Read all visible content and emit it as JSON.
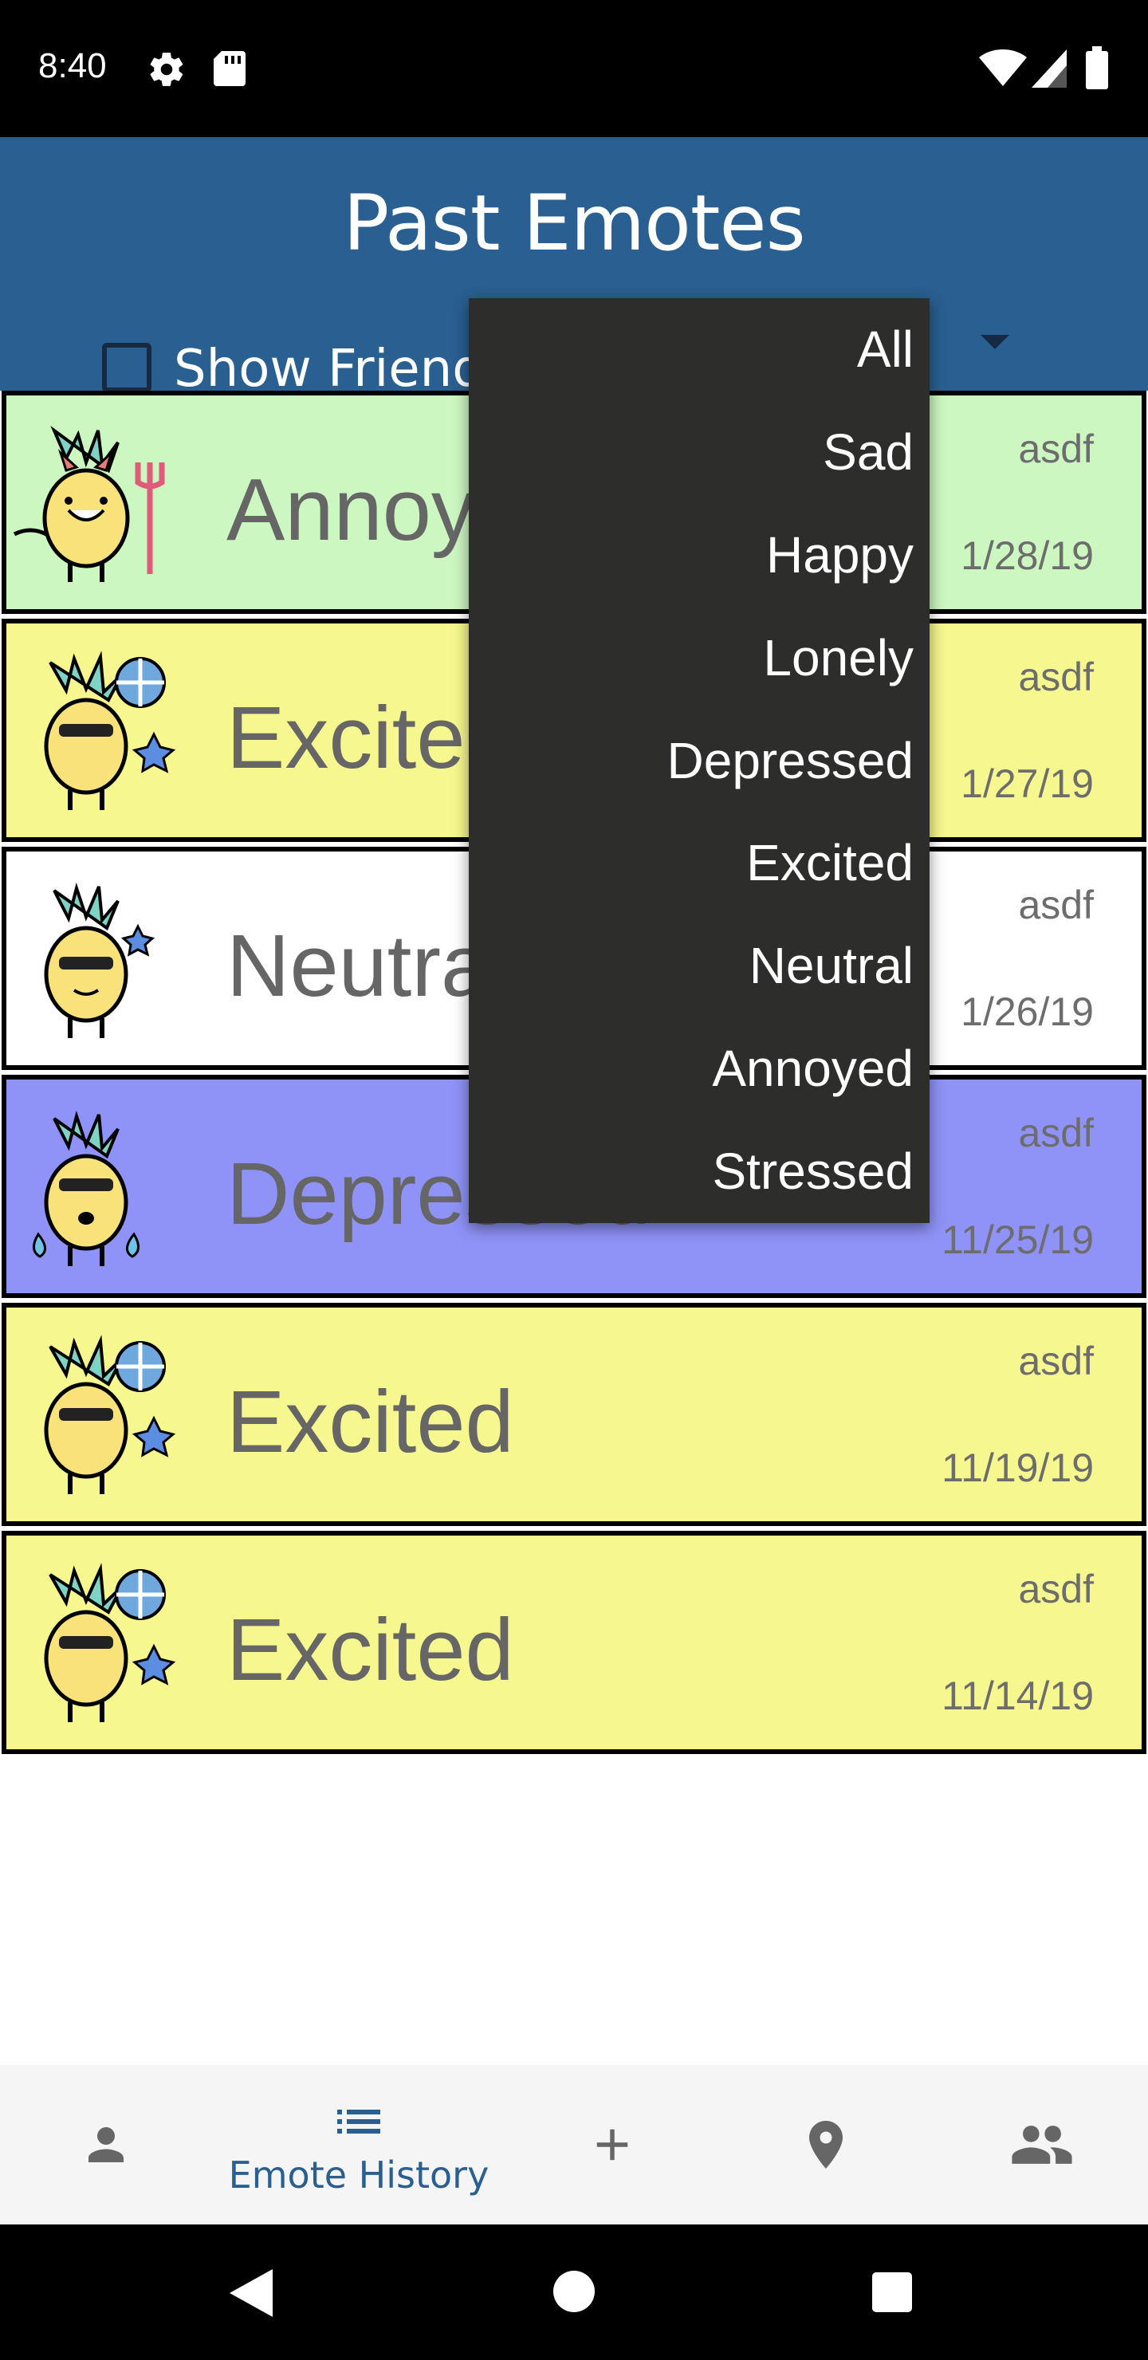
{
  "status_bar": {
    "time": "8:40"
  },
  "header": {
    "title": "Past Emotes",
    "show_friends_label": "Show Friends"
  },
  "dropdown": {
    "options": [
      "All",
      "Sad",
      "Happy",
      "Lonely",
      "Depressed",
      "Excited",
      "Neutral",
      "Annoyed",
      "Stressed"
    ]
  },
  "emotes": [
    {
      "emotion": "Annoyed",
      "user": "asdf",
      "date": "1/28/19",
      "color": "#ccf7c0"
    },
    {
      "emotion": "Excited",
      "user": "asdf",
      "date": "1/27/19",
      "color": "#f6f78f"
    },
    {
      "emotion": "Neutral",
      "user": "asdf",
      "date": "1/26/19",
      "color": "#ffffff"
    },
    {
      "emotion": "Depressed",
      "user": "asdf",
      "date": "11/25/19",
      "color": "#8f93f7"
    },
    {
      "emotion": "Excited",
      "user": "asdf",
      "date": "11/19/19",
      "color": "#f6f78f"
    },
    {
      "emotion": "Excited",
      "user": "asdf",
      "date": "11/14/19",
      "color": "#f6f78f"
    }
  ],
  "bottom_nav": {
    "items": [
      {
        "icon": "person-icon",
        "label": ""
      },
      {
        "icon": "list-icon",
        "label": "Emote History"
      },
      {
        "icon": "add-icon",
        "label": ""
      },
      {
        "icon": "location-pin-icon",
        "label": ""
      },
      {
        "icon": "group-icon",
        "label": ""
      }
    ],
    "active_color": "#295f91"
  },
  "theme": {
    "header": "#295f91",
    "dropdown_bg": "#2d2d2b"
  }
}
